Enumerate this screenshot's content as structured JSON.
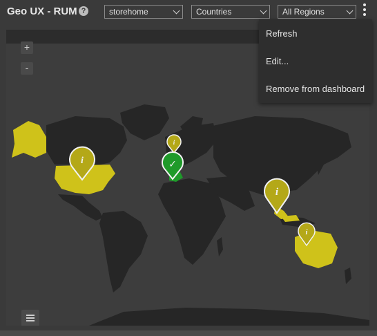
{
  "header": {
    "title": "Geo UX - RUM",
    "help_glyph": "?",
    "filters": [
      {
        "value": "storehome"
      },
      {
        "value": "Countries"
      },
      {
        "value": "All Regions"
      }
    ]
  },
  "menu": {
    "items": [
      "Refresh",
      "Edit...",
      "Remove from dashboard"
    ]
  },
  "map": {
    "zoom_in_label": "+",
    "zoom_out_label": "-",
    "highlight_color": "#cfc21a",
    "ok_color": "#1f9a2a",
    "marker_glyph_info": "i",
    "marker_glyph_ok": "✓",
    "markers": [
      {
        "region": "United States",
        "status": "info"
      },
      {
        "region": "Western Europe",
        "status": "info"
      },
      {
        "region": "Spain",
        "status": "ok"
      },
      {
        "region": "Southeast Asia",
        "status": "info"
      },
      {
        "region": "Australia",
        "status": "info"
      }
    ]
  }
}
